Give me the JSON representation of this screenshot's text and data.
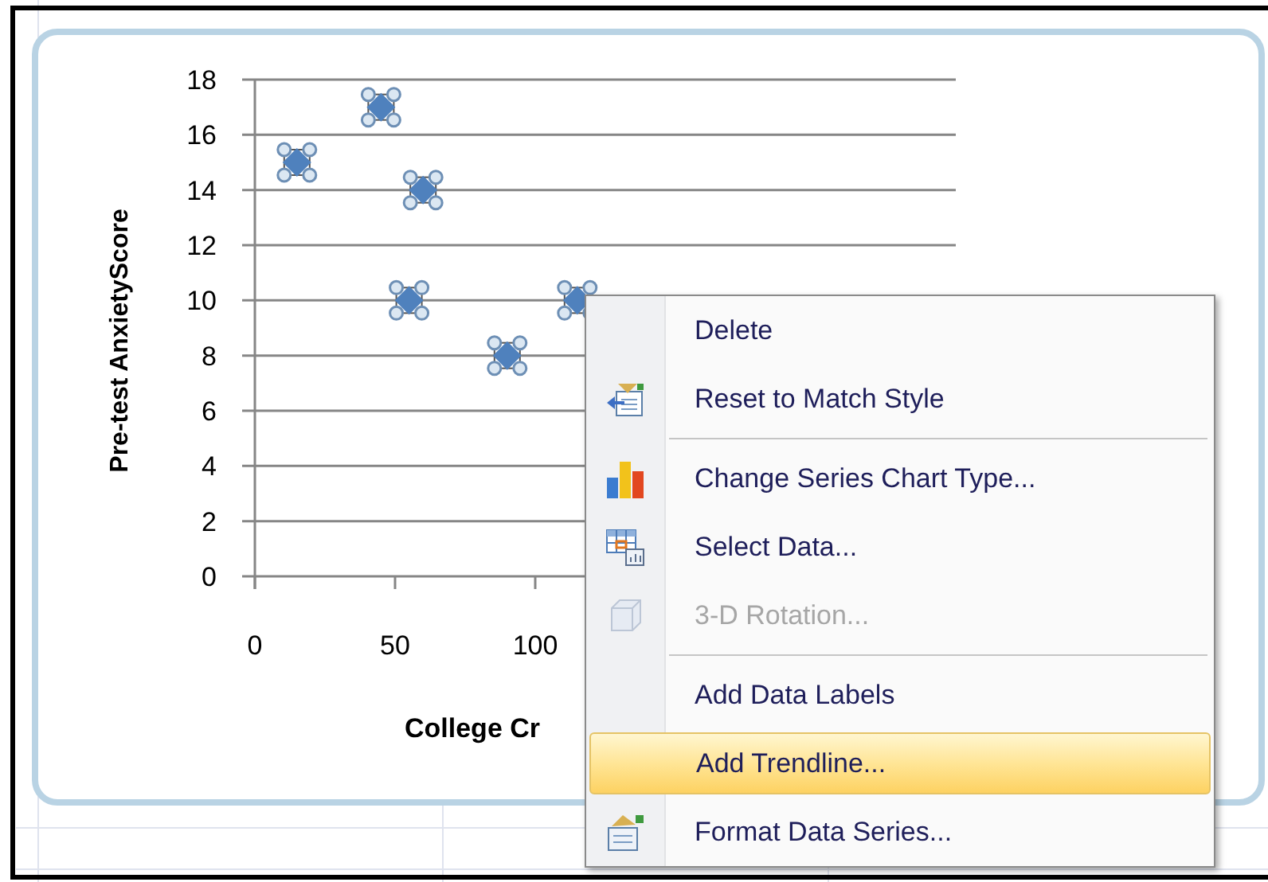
{
  "chart": {
    "series_selected": true,
    "chart_data": {
      "type": "scatter",
      "xlabel": "College Cr",
      "ylabel": "Pre-test AnxietyScore",
      "x": [
        15,
        45,
        60,
        55,
        90,
        115
      ],
      "series": [
        {
          "color": "#4f81bd",
          "values": [
            15,
            17,
            14,
            10,
            8,
            10
          ]
        }
      ],
      "xlim": [
        0,
        250
      ],
      "ylim": [
        0,
        18
      ],
      "xticks": [
        0,
        50,
        100
      ],
      "yticks": [
        0,
        2,
        4,
        6,
        8,
        10,
        12,
        14,
        16,
        18
      ],
      "grid": true
    }
  },
  "context_menu": {
    "items": [
      {
        "kind": "item",
        "label": "Delete",
        "disabled": false,
        "selected": false
      },
      {
        "kind": "item",
        "label": "Reset to Match Style",
        "disabled": false,
        "selected": false
      },
      {
        "kind": "separator"
      },
      {
        "kind": "item",
        "label": "Change Series Chart Type...",
        "disabled": false,
        "selected": false
      },
      {
        "kind": "item",
        "label": "Select Data...",
        "disabled": false,
        "selected": false
      },
      {
        "kind": "item",
        "label": "3-D Rotation...",
        "disabled": true,
        "selected": false
      },
      {
        "kind": "separator"
      },
      {
        "kind": "item",
        "label": "Add Data Labels",
        "disabled": false,
        "selected": false
      },
      {
        "kind": "item",
        "label": "Add Trendline...",
        "disabled": false,
        "selected": true
      },
      {
        "kind": "item",
        "label": "Format Data Series...",
        "disabled": false,
        "selected": false
      }
    ]
  }
}
